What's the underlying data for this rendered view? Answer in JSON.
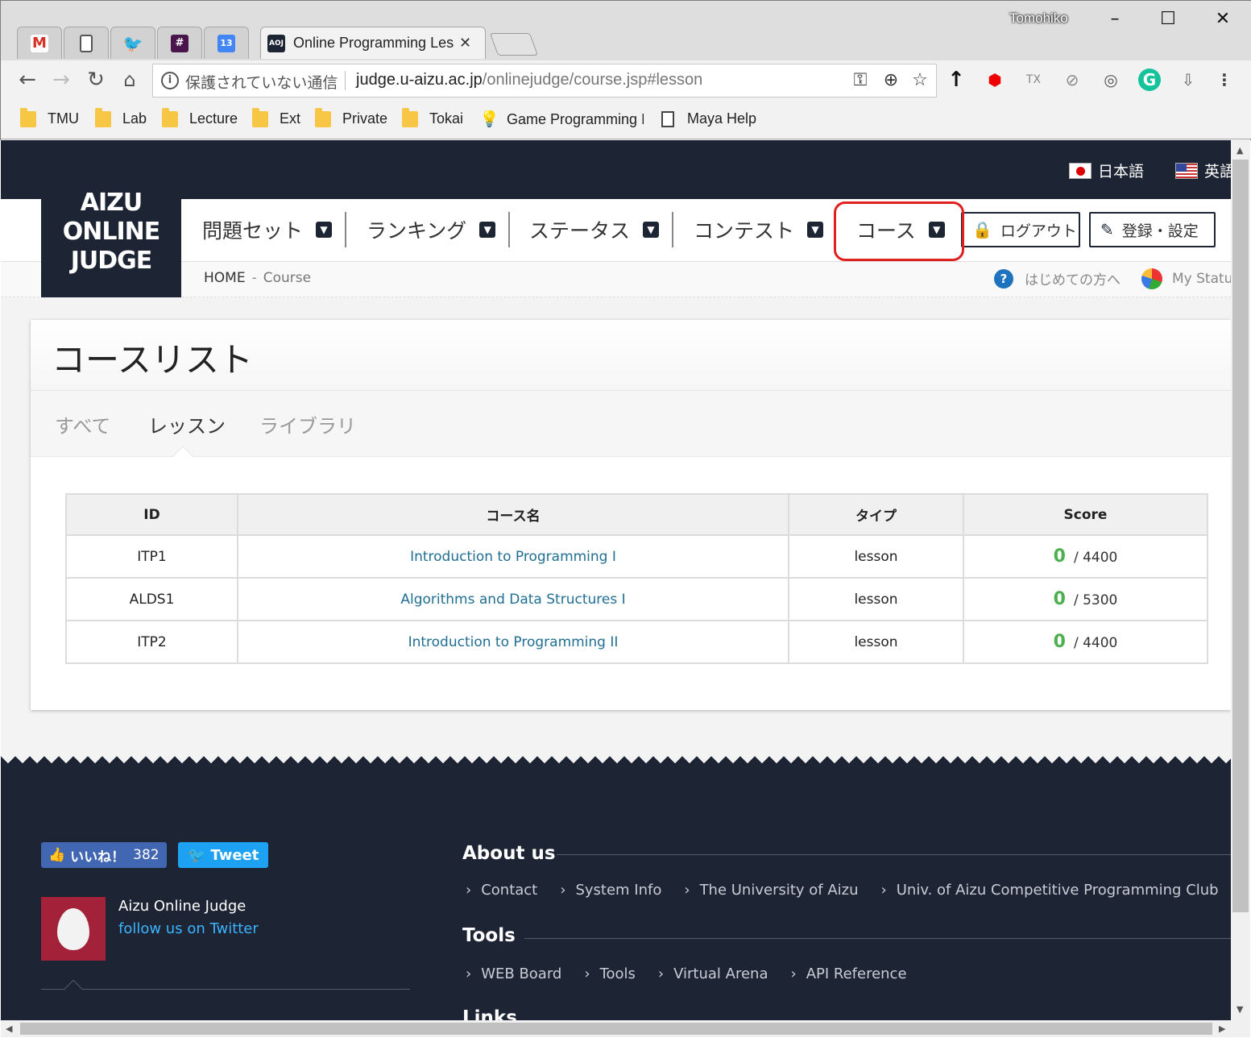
{
  "browser": {
    "user_name": "Tomohiko",
    "active_tab_title": "Online Programming Less",
    "tab_favicons": [
      "gmail-icon",
      "page-icon",
      "twitter-icon",
      "slack-icon",
      "calendar-icon"
    ],
    "calendar_day": "13",
    "security_text": "保護されていない通信",
    "url_host": "judge.u-aizu.ac.jp",
    "url_path": "/onlinejudge/course.jsp#lesson",
    "bookmarks": [
      "TMU",
      "Lab",
      "Lecture",
      "Ext",
      "Private",
      "Tokai",
      "Game Programming I",
      "Maya Help"
    ]
  },
  "site": {
    "logo_lines": [
      "AIZU",
      "ONLINE",
      "JUDGE"
    ],
    "lang_ja": "日本語",
    "lang_en": "英語",
    "menu": [
      "問題セット",
      "ランキング",
      "ステータス",
      "コンテスト",
      "コース"
    ],
    "logout": "ログアウト",
    "settings": "登録・設定",
    "breadcrumb_home": "HOME",
    "breadcrumb_sep": "-",
    "breadcrumb_current": "Course",
    "beginners": "はじめての方へ",
    "my_status": "My Statu"
  },
  "panel": {
    "title": "コースリスト",
    "tabs": [
      "すべて",
      "レッスン",
      "ライブラリ"
    ],
    "active_tab": "レッスン",
    "columns": [
      "ID",
      "コース名",
      "タイプ",
      "Score"
    ],
    "rows": [
      {
        "id": "ITP1",
        "name": "Introduction to Programming I",
        "type": "lesson",
        "score": "0",
        "total": "/ 4400"
      },
      {
        "id": "ALDS1",
        "name": "Algorithms and Data Structures I",
        "type": "lesson",
        "score": "0",
        "total": "/ 5300"
      },
      {
        "id": "ITP2",
        "name": "Introduction to Programming II",
        "type": "lesson",
        "score": "0",
        "total": "/ 4400"
      }
    ]
  },
  "footer": {
    "like_label": "いいね！",
    "like_count": "382",
    "tweet_label": "Tweet",
    "twitter_name": "Aizu Online Judge",
    "twitter_follow": "follow us on Twitter",
    "about_title": "About us",
    "about_links": [
      "Contact",
      "System Info",
      "The University of Aizu",
      "Univ. of Aizu Competitive Programming Club"
    ],
    "tools_title": "Tools",
    "tools_links": [
      "WEB Board",
      "Tools",
      "Virtual Arena",
      "API Reference"
    ],
    "links_title": "Links"
  },
  "colors": {
    "navy": "#1d2433",
    "highlight_red": "#e02020",
    "link_blue": "#1f6e93",
    "score_green": "#4caf50"
  }
}
